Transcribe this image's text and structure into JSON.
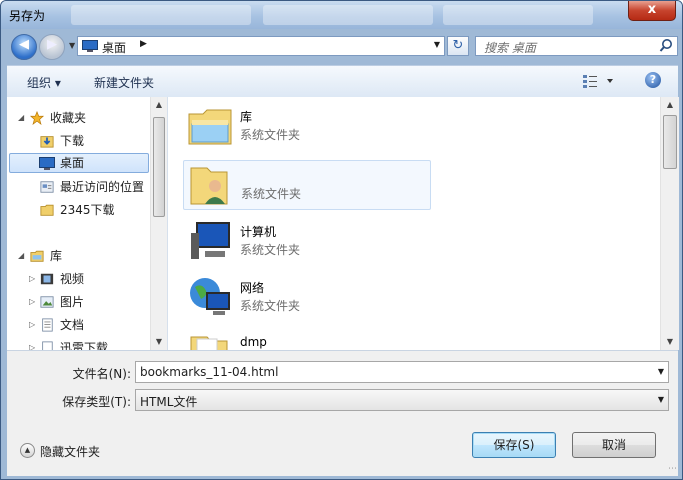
{
  "window": {
    "title": "另存为",
    "close_glyph": "x"
  },
  "address": {
    "location": "桌面",
    "search_placeholder": "搜索 桌面"
  },
  "toolbar": {
    "organize": "组织 ▾",
    "new_folder": "新建文件夹",
    "help": "?"
  },
  "nav": {
    "favorites": "收藏夹",
    "downloads": "下载",
    "desktop": "桌面",
    "recent": "最近访问的位置",
    "dl2345": "2345下载",
    "libraries": "库",
    "videos": "视频",
    "pictures": "图片",
    "documents": "文档",
    "thunder": "迅雷下载"
  },
  "files": [
    {
      "name": "库",
      "type": "系统文件夹",
      "icon": "library-folder-icon"
    },
    {
      "name": "",
      "type": "系统文件夹",
      "icon": "user-folder-icon"
    },
    {
      "name": "计算机",
      "type": "系统文件夹",
      "icon": "computer-icon"
    },
    {
      "name": "网络",
      "type": "系统文件夹",
      "icon": "network-icon"
    },
    {
      "name": "dmp",
      "type": "",
      "icon": "folder-icon"
    }
  ],
  "form": {
    "filename_label": "文件名(N):",
    "filename_value": "bookmarks_11-04.html",
    "filetype_label": "保存类型(T):",
    "filetype_value": "HTML文件",
    "hide_folders": "隐藏文件夹",
    "save": "保存(S)",
    "cancel": "取消"
  },
  "colors": {
    "accent": "#3c7fb1",
    "selection": "#cfe3fb"
  }
}
